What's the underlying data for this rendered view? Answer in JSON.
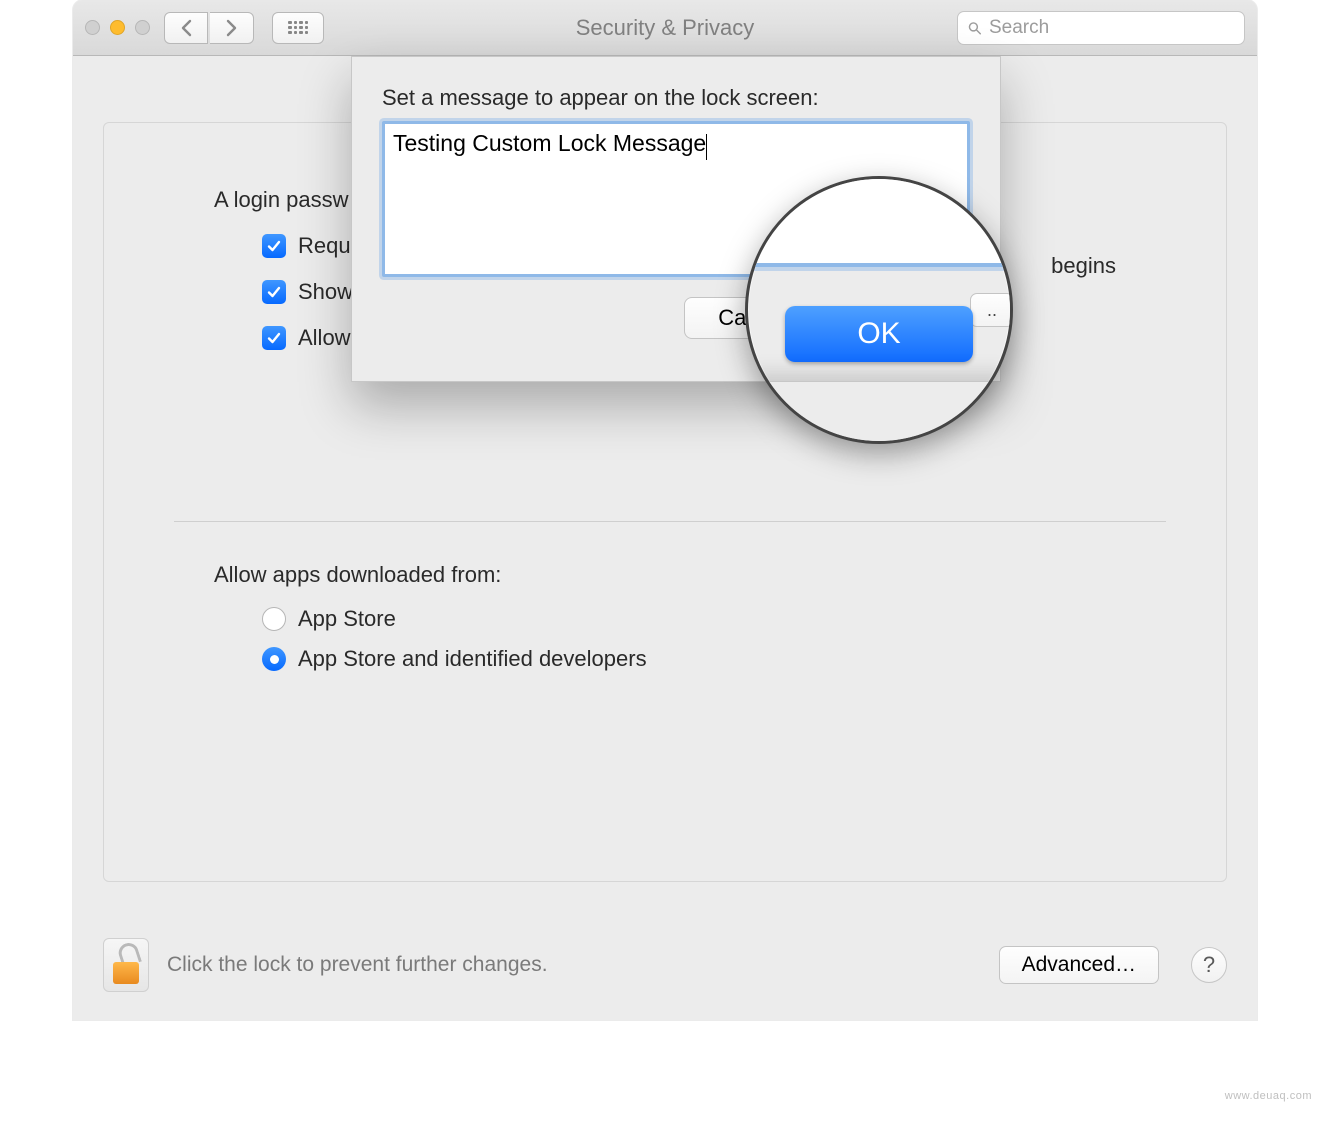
{
  "window": {
    "title": "Security & Privacy"
  },
  "toolbar": {
    "search_placeholder": "Search"
  },
  "panel": {
    "heading_fragment": "A login passw",
    "opt1_fragment": "Requi",
    "opt1_trailing": "begins",
    "opt2_fragment": "Show",
    "opt3_fragment": "Allow",
    "allow_heading": "Allow apps downloaded from:",
    "radio1": "App Store",
    "radio2": "App Store and identified developers"
  },
  "sheet": {
    "prompt": "Set a message to appear on the lock screen:",
    "value": "Testing Custom Lock Message",
    "cancel_label": "Cance",
    "ok_label": "OK"
  },
  "magnifier": {
    "ok_label": "OK",
    "dots_label": ".."
  },
  "footer": {
    "hint": "Click the lock to prevent further changes.",
    "advanced_label": "Advanced…",
    "help_label": "?"
  },
  "watermark": "www.deuaq.com"
}
